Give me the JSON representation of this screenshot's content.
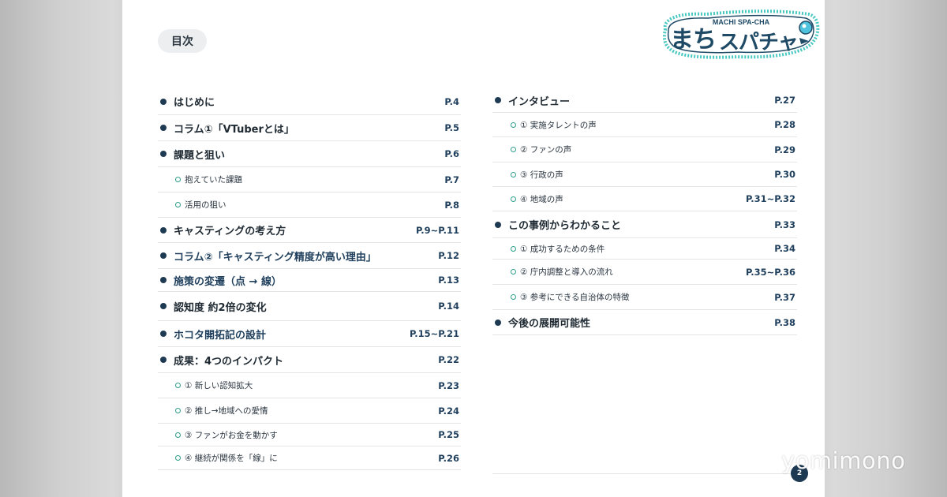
{
  "toc_label": "目次",
  "logo": {
    "main": "まちスパチャ",
    "sub": "MACHI SPA-CHA"
  },
  "left": [
    {
      "label": "はじめに",
      "page": "P.4",
      "sub": false,
      "h": 34
    },
    {
      "label": "コラム①「VTuberとは」",
      "page": "P.5",
      "sub": false,
      "h": 33
    },
    {
      "label": "課題と狙い",
      "page": "P.6",
      "sub": false,
      "h": 33
    },
    {
      "label": "抱えていた課題",
      "page": "P.7",
      "sub": true,
      "h": 32
    },
    {
      "label": "活用の狙い",
      "page": "P.8",
      "sub": true,
      "h": 32
    },
    {
      "label": "キャスティングの考え方",
      "page": "P.9~P.11",
      "sub": false,
      "h": 32
    },
    {
      "label": "コラム②「キャスティング精度が高い理由」",
      "page": "P.12",
      "sub": false,
      "h": 33,
      "blue": true
    },
    {
      "label": "施策の変遷（点 → 線）",
      "page": "P.13",
      "sub": false,
      "h": 29,
      "blue": true
    },
    {
      "label": "認知度 約2倍の変化",
      "page": "P.14",
      "sub": false,
      "h": 37
    },
    {
      "label": "ホコタ開拓記の設計",
      "page": "P.15~P.21",
      "sub": false,
      "h": 33,
      "blue": true
    },
    {
      "label": "成果：4つのインパクト",
      "page": "P.22",
      "sub": false,
      "h": 33
    },
    {
      "label": "① 新しい認知拡大",
      "page": "P.23",
      "sub": true,
      "h": 32
    },
    {
      "label": "② 推し→地域への愛情",
      "page": "P.24",
      "sub": true,
      "h": 32
    },
    {
      "label": "③ ファンがお金を動かす",
      "page": "P.25",
      "sub": true,
      "h": 29
    },
    {
      "label": "④ 継続が関係を「線」に",
      "page": "P.26",
      "sub": true,
      "h": 30
    }
  ],
  "right": [
    {
      "label": "インタビュー",
      "page": "P.27",
      "sub": false,
      "h": 31
    },
    {
      "label": "① 実施タレントの声",
      "page": "P.28",
      "sub": true,
      "h": 31
    },
    {
      "label": "② ファンの声",
      "page": "P.29",
      "sub": true,
      "h": 32
    },
    {
      "label": "③ 行政の声",
      "page": "P.30",
      "sub": true,
      "h": 31
    },
    {
      "label": "④ 地域の声",
      "page": "P.31~P.32",
      "sub": true,
      "h": 31
    },
    {
      "label": "この事例からわかること",
      "page": "P.33",
      "sub": false,
      "h": 34
    },
    {
      "label": "① 成功するための条件",
      "page": "P.34",
      "sub": true,
      "h": 27
    },
    {
      "label": "② 庁内調整と導入の流れ",
      "page": "P.35~P.36",
      "sub": true,
      "h": 32
    },
    {
      "label": "③ 参考にできる自治体の特徴",
      "page": "P.37",
      "sub": true,
      "h": 32
    },
    {
      "label": "今後の展開可能性",
      "page": "P.38",
      "sub": false,
      "h": 32
    }
  ],
  "page_number": "2",
  "watermark": "yomimono"
}
